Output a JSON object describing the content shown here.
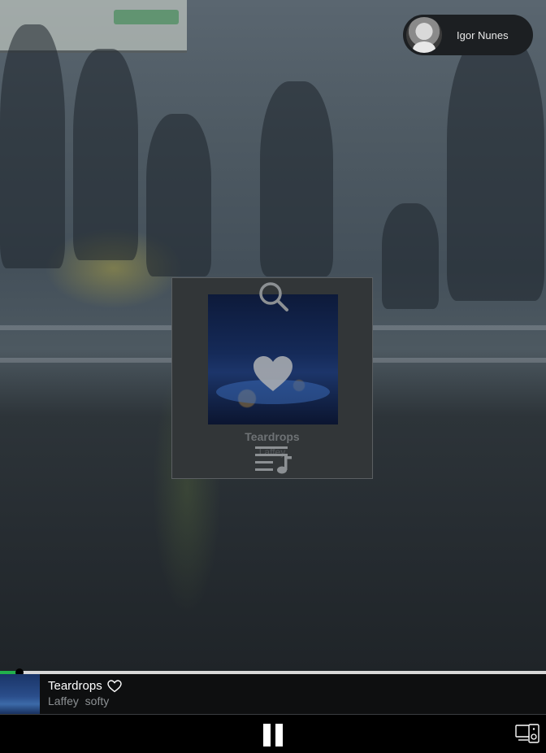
{
  "user": {
    "name": "Igor Nunes"
  },
  "card": {
    "title": "Teardrops",
    "artist": "Laffey",
    "icons": [
      "search-icon",
      "heart-icon",
      "queue-icon"
    ]
  },
  "player": {
    "title": "Teardrops",
    "artist": "Laffey",
    "album": "softy",
    "progress": 0.035,
    "icons": [
      "heart-outline-icon",
      "pause-icon",
      "device-icon"
    ],
    "colors": {
      "progress_fill": "#22b14c",
      "progress_track": "#d8d8d8"
    }
  }
}
